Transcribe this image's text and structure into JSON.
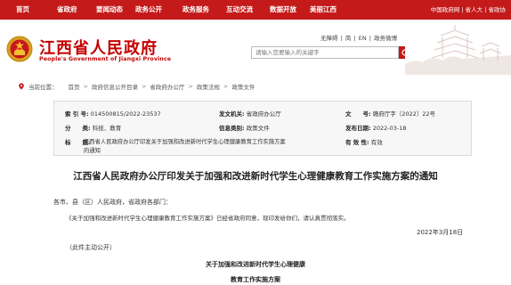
{
  "topnav": {
    "items": [
      "首页",
      "省政府",
      "要闻动态",
      "政务公开",
      "政务服务",
      "互动交流",
      "数据开放",
      "美丽江西"
    ],
    "right_links": [
      "中国政府网",
      "省人大",
      "省政协"
    ]
  },
  "header": {
    "title": "江西省人民政府",
    "subtitle": "People's Government of Jiangxi Province",
    "util_links": [
      "无障碍",
      "简",
      "EN",
      "政务微博"
    ],
    "search_placeholder": "请输入您要输入的关键字"
  },
  "breadcrumb": {
    "label": "当前位置：",
    "items": [
      "首页",
      "政府信息公开目录",
      "省政府办公厅",
      "政策法规",
      "政策文件"
    ]
  },
  "info": {
    "index_label": "索 引 号:",
    "index_value": "014500815/2022-23537",
    "issuer_label": "发文机关:",
    "issuer_value": "省政府办公厅",
    "docno_label": "文　　号:",
    "docno_value": "赣府厅字〔2022〕22号",
    "category_label": "分　　类:",
    "category_value": "科技、教育",
    "genre_label": "信息类别:",
    "genre_value": "政策文件",
    "date_label": "发布日期:",
    "date_value": "2022-03-18",
    "title_label": "标　　题:",
    "title_value_1": "江西省人民政府办公厅印发关于加强和改进新时代学生心理健康教育工作实施方案",
    "title_value_2": "的通知",
    "valid_label": "有 效 性:",
    "valid_value": "有效"
  },
  "doc": {
    "title": "江西省人民政府办公厅印发关于加强和改进新时代学生心理健康教育工作实施方案的通知",
    "salutation": "各市、县（区）人民政府，省政府各部门：",
    "body": "《关于加强和改进新时代学生心理健康教育工作实施方案》已经省政府同意，现印发给你们，请认真贯彻落实。",
    "date": "2022年3月18日",
    "public_note": "（此件主动公开）",
    "section_title_1": "关于加强和改进新时代学生心理健康",
    "section_title_2": "教育工作实施方案"
  }
}
